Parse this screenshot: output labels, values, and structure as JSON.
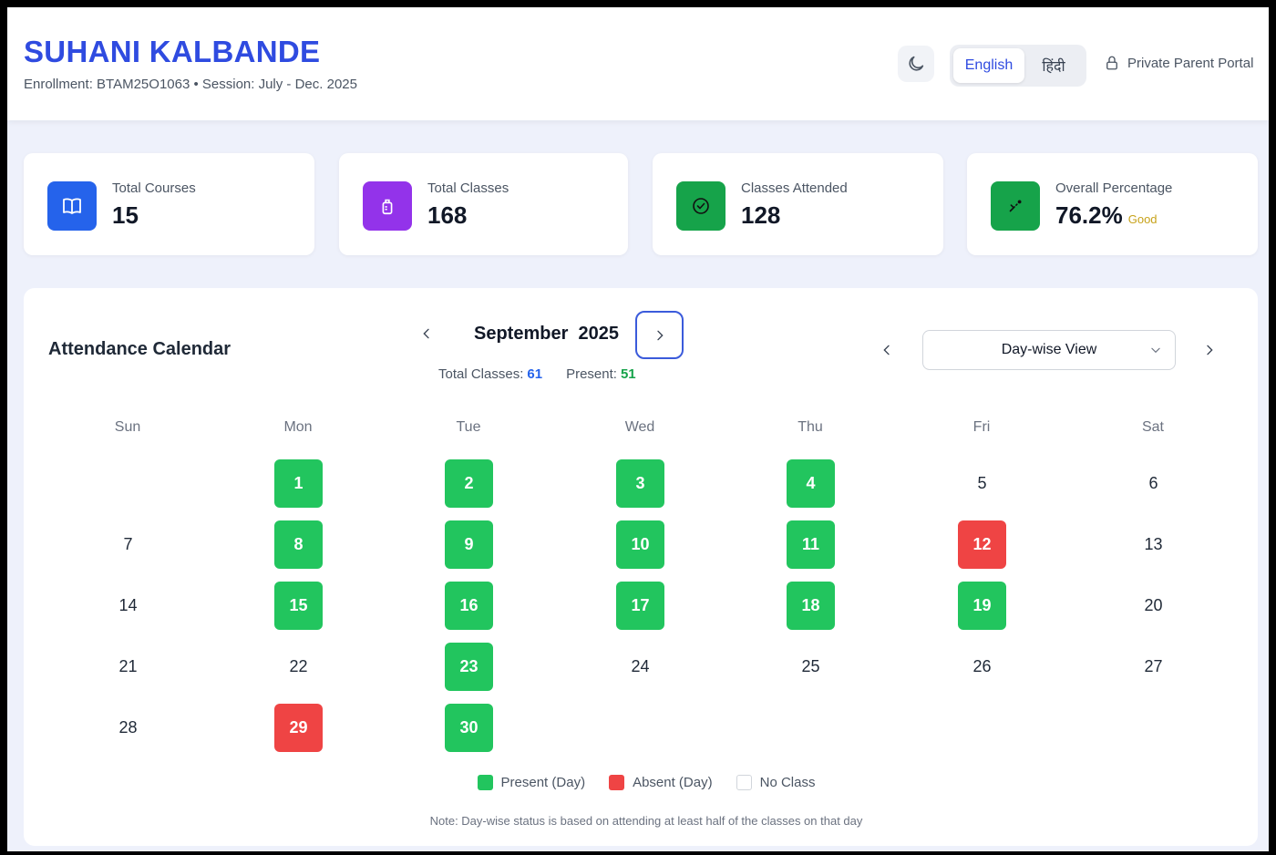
{
  "header": {
    "student_name": "SUHANI KALBANDE",
    "subtitle": "Enrollment: BTAM25O1063 • Session: July - Dec. 2025",
    "lang_english": "English",
    "lang_hindi": "हिंदी",
    "portal_label": "Private Parent Portal"
  },
  "stats": [
    {
      "label": "Total Courses",
      "value": "15",
      "icon": "book-icon",
      "color": "#2563eb"
    },
    {
      "label": "Total Classes",
      "value": "168",
      "icon": "calendar-clip-icon",
      "color": "#9333ea"
    },
    {
      "label": "Classes Attended",
      "value": "128",
      "icon": "check-circle-icon",
      "color": "#16a34a"
    },
    {
      "label": "Overall Percentage",
      "value": "76.2%",
      "badge": "Good",
      "icon": "trend-icon",
      "color": "#16a34a"
    }
  ],
  "calendar": {
    "title": "Attendance Calendar",
    "month": "September",
    "year": "2025",
    "total_label": "Total Classes:",
    "total_value": "61",
    "present_label": "Present:",
    "present_value": "51",
    "view": "Day-wise View",
    "weekdays": [
      "Sun",
      "Mon",
      "Tue",
      "Wed",
      "Thu",
      "Fri",
      "Sat"
    ],
    "days": [
      {
        "d": "1",
        "status": "present"
      },
      {
        "d": "2",
        "status": "present"
      },
      {
        "d": "3",
        "status": "present"
      },
      {
        "d": "4",
        "status": "present"
      },
      {
        "d": "5",
        "status": "none"
      },
      {
        "d": "6",
        "status": "none"
      },
      {
        "d": "7",
        "status": "none"
      },
      {
        "d": "8",
        "status": "present"
      },
      {
        "d": "9",
        "status": "present"
      },
      {
        "d": "10",
        "status": "present"
      },
      {
        "d": "11",
        "status": "present"
      },
      {
        "d": "12",
        "status": "absent"
      },
      {
        "d": "13",
        "status": "none"
      },
      {
        "d": "14",
        "status": "none"
      },
      {
        "d": "15",
        "status": "present"
      },
      {
        "d": "16",
        "status": "present"
      },
      {
        "d": "17",
        "status": "present"
      },
      {
        "d": "18",
        "status": "present"
      },
      {
        "d": "19",
        "status": "present"
      },
      {
        "d": "20",
        "status": "none"
      },
      {
        "d": "21",
        "status": "none"
      },
      {
        "d": "22",
        "status": "none"
      },
      {
        "d": "23",
        "status": "present"
      },
      {
        "d": "24",
        "status": "none"
      },
      {
        "d": "25",
        "status": "none"
      },
      {
        "d": "26",
        "status": "none"
      },
      {
        "d": "27",
        "status": "none"
      },
      {
        "d": "28",
        "status": "none"
      },
      {
        "d": "29",
        "status": "absent"
      },
      {
        "d": "30",
        "status": "present"
      }
    ],
    "legend": {
      "present": "Present (Day)",
      "absent": "Absent (Day)",
      "none": "No Class"
    },
    "note": "Note: Day-wise status is based on attending at least half of the classes on that day"
  }
}
